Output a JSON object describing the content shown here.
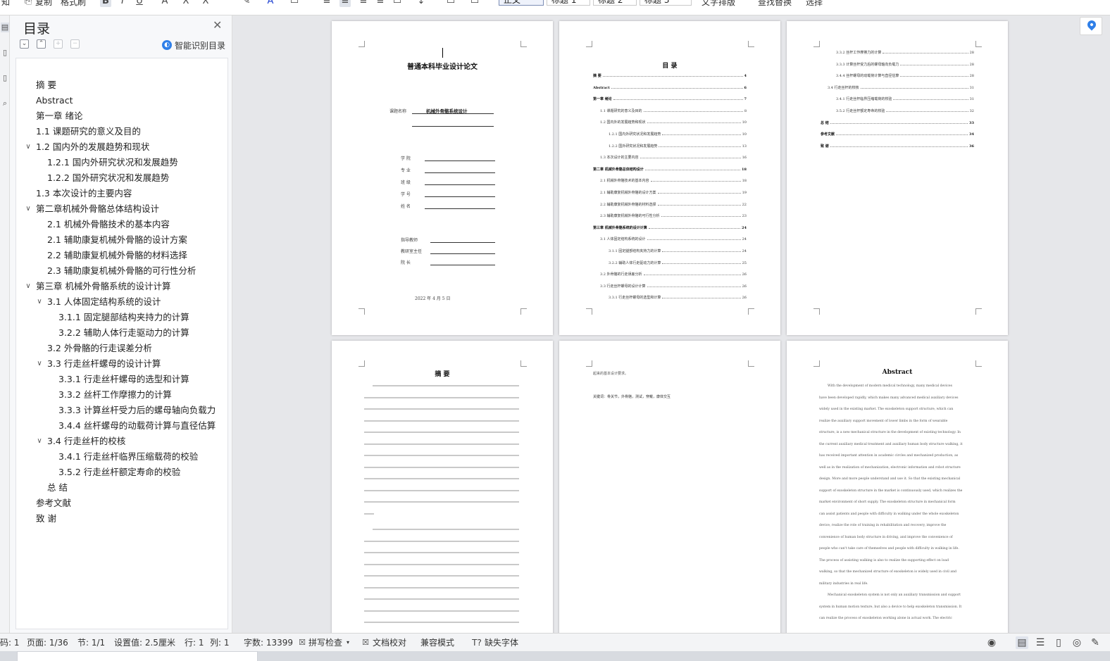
{
  "ribbon": {
    "paste_label": "复制",
    "format_painter_label": "格式刷",
    "styles": [
      "正文",
      "标题 1",
      "标题 2",
      "标题 3"
    ],
    "text_layout_label": "文字排版",
    "find_replace_label": "查找替换",
    "select_label": "选择"
  },
  "toc_panel": {
    "title": "目录",
    "smart_toc_label": "智能识别目录",
    "items": [
      {
        "label": "摘  要",
        "level": 1,
        "expandable": false
      },
      {
        "label": "Abstract",
        "level": 1,
        "expandable": false
      },
      {
        "label": "第一章  绪论",
        "level": 1,
        "expandable": false
      },
      {
        "label": "1.1 课题研究的意义及目的",
        "level": 1,
        "expandable": false
      },
      {
        "label": "1.2  国内外的发展趋势和现状",
        "level": 1,
        "expandable": true
      },
      {
        "label": "1.2.1 国内外研究状况和发展趋势",
        "level": 2,
        "expandable": false
      },
      {
        "label": "1.2.2 国外研究状况和发展趋势",
        "level": 2,
        "expandable": false
      },
      {
        "label": "1.3 本次设计的主要内容",
        "level": 1,
        "expandable": false
      },
      {
        "label": "第二章机械外骨骼总体结构设计",
        "level": 1,
        "expandable": true
      },
      {
        "label": "2.1 机械外骨骼技术的基本内容",
        "level": 2,
        "expandable": false
      },
      {
        "label": "2.1 辅助康复机械外骨骼的设计方案",
        "level": 2,
        "expandable": false
      },
      {
        "label": "2.2  辅助康复机械外骨骼的材料选择",
        "level": 2,
        "expandable": false
      },
      {
        "label": "2.3  辅助康复机械外骨骼的可行性分析",
        "level": 2,
        "expandable": false
      },
      {
        "label": "第三章  机械外骨骼系统的设计计算",
        "level": 1,
        "expandable": true
      },
      {
        "label": "3.1 人体固定结构系统的设计",
        "level": 2,
        "expandable": true
      },
      {
        "label": "3.1.1 固定腿部结构夹持力的计算",
        "level": 3,
        "expandable": false
      },
      {
        "label": "3.2.2 辅助人体行走驱动力的计算",
        "level": 3,
        "expandable": false
      },
      {
        "label": "3.2 外骨骼的行走误差分析",
        "level": 2,
        "expandable": false
      },
      {
        "label": "3.3 行走丝杆螺母的设计计算",
        "level": 2,
        "expandable": true
      },
      {
        "label": "3.3.1 行走丝杆螺母的选型和计算",
        "level": 3,
        "expandable": false
      },
      {
        "label": "3.3.2 丝杆工作摩擦力的计算",
        "level": 3,
        "expandable": false
      },
      {
        "label": "3.3.3 计算丝杆受力后的螺母轴向负载力",
        "level": 3,
        "expandable": false
      },
      {
        "label": "3.4.4 丝杆螺母的动载荷计算与直径估算",
        "level": 3,
        "expandable": false
      },
      {
        "label": "3.4 行走丝杆的校核",
        "level": 2,
        "expandable": true
      },
      {
        "label": "3.4.1 行走丝杆临界压缩载荷的校验",
        "level": 3,
        "expandable": false
      },
      {
        "label": "3.5.2 行走丝杆额定寿命的校验",
        "level": 3,
        "expandable": false
      },
      {
        "label": "总  结",
        "level": 2,
        "expandable": false
      },
      {
        "label": "参考文献",
        "level": 1,
        "expandable": false
      },
      {
        "label": "致  谢",
        "level": 1,
        "expandable": false
      }
    ]
  },
  "pages": {
    "cover": {
      "title": "普通本科毕业设计论文",
      "topic_label": "课题名称",
      "topic_value": "机械外骨骼系统设计",
      "fields": [
        "学    院",
        "专    业",
        "班    级",
        "学    号",
        "姓    名"
      ],
      "advisors": [
        "指导教师",
        "教研室主任",
        "院    长"
      ],
      "date": "2022 年 4 月 5 日"
    },
    "toc_page1": {
      "heading": "目  录",
      "rows": [
        {
          "t": "摘  要",
          "p": "4",
          "b": true,
          "indent": 0
        },
        {
          "t": "Abstract",
          "p": "6",
          "b": true,
          "indent": 0
        },
        {
          "t": "第一章  绪论",
          "p": "7",
          "b": true,
          "indent": 0
        },
        {
          "t": "1.1 课题研究的意义及目的",
          "p": "8",
          "b": false,
          "indent": 1
        },
        {
          "t": "1.2 国内外的发展趋势和现状",
          "p": "10",
          "b": false,
          "indent": 1
        },
        {
          "t": "1.2.1 国内外研究状况和发展趋势",
          "p": "10",
          "b": false,
          "indent": 2
        },
        {
          "t": "1.2.2 国外研究状况和发展趋势",
          "p": "13",
          "b": false,
          "indent": 2
        },
        {
          "t": "1.3 本次设计的主要内容",
          "p": "16",
          "b": false,
          "indent": 1
        },
        {
          "t": "第二章  机械外骨骼总体结构设计",
          "p": "18",
          "b": true,
          "indent": 0
        },
        {
          "t": "2.1 机械外骨骼技术的基本内容",
          "p": "18",
          "b": false,
          "indent": 1
        },
        {
          "t": "2.1 辅助康复机械外骨骼的设计方案",
          "p": "19",
          "b": false,
          "indent": 1
        },
        {
          "t": "2.2 辅助康复机械外骨骼的材料选择",
          "p": "22",
          "b": false,
          "indent": 1
        },
        {
          "t": "2.3 辅助康复机械外骨骼的可行性分析",
          "p": "23",
          "b": false,
          "indent": 1
        },
        {
          "t": "第三章  机械外骨骼系统的设计计算",
          "p": "24",
          "b": true,
          "indent": 0
        },
        {
          "t": "3.1 人体固定结构系统的设计",
          "p": "24",
          "b": false,
          "indent": 1
        },
        {
          "t": "3.1.1 固定腿部结构夹持力的计算",
          "p": "24",
          "b": false,
          "indent": 2
        },
        {
          "t": "3.2.2 辅助人体行走驱动力的计算",
          "p": "25",
          "b": false,
          "indent": 2
        },
        {
          "t": "3.2 外骨骼的行走误差分析",
          "p": "26",
          "b": false,
          "indent": 1
        },
        {
          "t": "3.3 行走丝杆螺母的设计计算",
          "p": "26",
          "b": false,
          "indent": 1
        },
        {
          "t": "3.3.1 行走丝杆螺母的选型和计算",
          "p": "26",
          "b": false,
          "indent": 2
        }
      ]
    },
    "toc_page2": {
      "rows": [
        {
          "t": "3.3.2 丝杆工作摩擦力的计算",
          "p": "28",
          "b": false,
          "indent": 2
        },
        {
          "t": "3.3.3 计算丝杆受力后的螺母轴向负载力",
          "p": "28",
          "b": false,
          "indent": 2
        },
        {
          "t": "3.4.4 丝杆螺母的动载荷计算与直径估算",
          "p": "28",
          "b": false,
          "indent": 2
        },
        {
          "t": "3.4 行走丝杆的校核",
          "p": "31",
          "b": false,
          "indent": 1
        },
        {
          "t": "3.4.1 行走丝杆临界压缩载荷的校验",
          "p": "31",
          "b": false,
          "indent": 2
        },
        {
          "t": "3.5.2 行走丝杆额定寿命的校验",
          "p": "32",
          "b": false,
          "indent": 2
        },
        {
          "t": "总  结",
          "p": "33",
          "b": true,
          "indent": 0
        },
        {
          "t": "参考文献",
          "p": "34",
          "b": true,
          "indent": 0
        },
        {
          "t": "致  谢",
          "p": "36",
          "b": true,
          "indent": 0
        }
      ]
    },
    "abstract_cn": {
      "heading": "摘  要"
    },
    "keywords_page": {
      "line1": "起来的基本设计要求。",
      "keywords": "关键词：骨关节，外骨骼，测试，穿戴，康体交互"
    },
    "abstract_en": {
      "heading": "Abstract",
      "lines": [
        "With the development of modern medical technology, many medical devices",
        "have been developed rapidly, which makes many advanced medical auxiliary devices",
        "widely used in the existing market. The exoskeleton support structure, which can",
        "realize the auxiliary support movement of lower limbs in the form of wearable",
        "structure, is a new mechanical structure in the development of existing technology. In",
        "the current auxiliary medical treatment and auxiliary human body structure walking, it",
        "has received important attention in academic circles and mechanized production, as",
        "well as in the realization of mechanization, electronic information and robot structure",
        "design. More and more people understand and use it. So that the existing mechanical",
        "support of exoskeleton structure in the market is continuously used, which realizes the",
        "market environment of short supply. The exoskeleton structure in mechanical form",
        "can assist patients and people with difficulty in walking under the whole exoskeleton",
        "device, realize the role of training in rehabilitation and recovery, improve the",
        "convenience of human body structure in driving, and improve the convenience of",
        "people who can't take care of themselves and people with difficulty in walking in life.",
        "The process of assisting walking is also to realize the supporting effect on load",
        "walking, so that the mechanized structure of exoskeleton is widely used in civil and",
        "military industries in real life.",
        "Mechanical exoskeleton system is not only an auxiliary transmission and support",
        "system in human motion texture, but also a device to help exoskeleton transmission. It",
        "can realize the process of exoskeleton working alone in actual work. The electric"
      ]
    }
  },
  "status_bar": {
    "section_cut": "码: 1",
    "page": "页面: 1/36",
    "section": "节: 1/1",
    "setting": "设置值: 2.5厘米",
    "row": "行: 1",
    "col": "列: 1",
    "word_count": "字数: 13399",
    "spell_check": "拼写检查",
    "proofread": "文档校对",
    "compat_mode": "兼容模式",
    "missing_fonts": "缺失字体"
  },
  "colors": {
    "accent": "#2f7fe8",
    "panel_bg": "#f7f8fa",
    "doc_bg": "#e6e7ea"
  }
}
